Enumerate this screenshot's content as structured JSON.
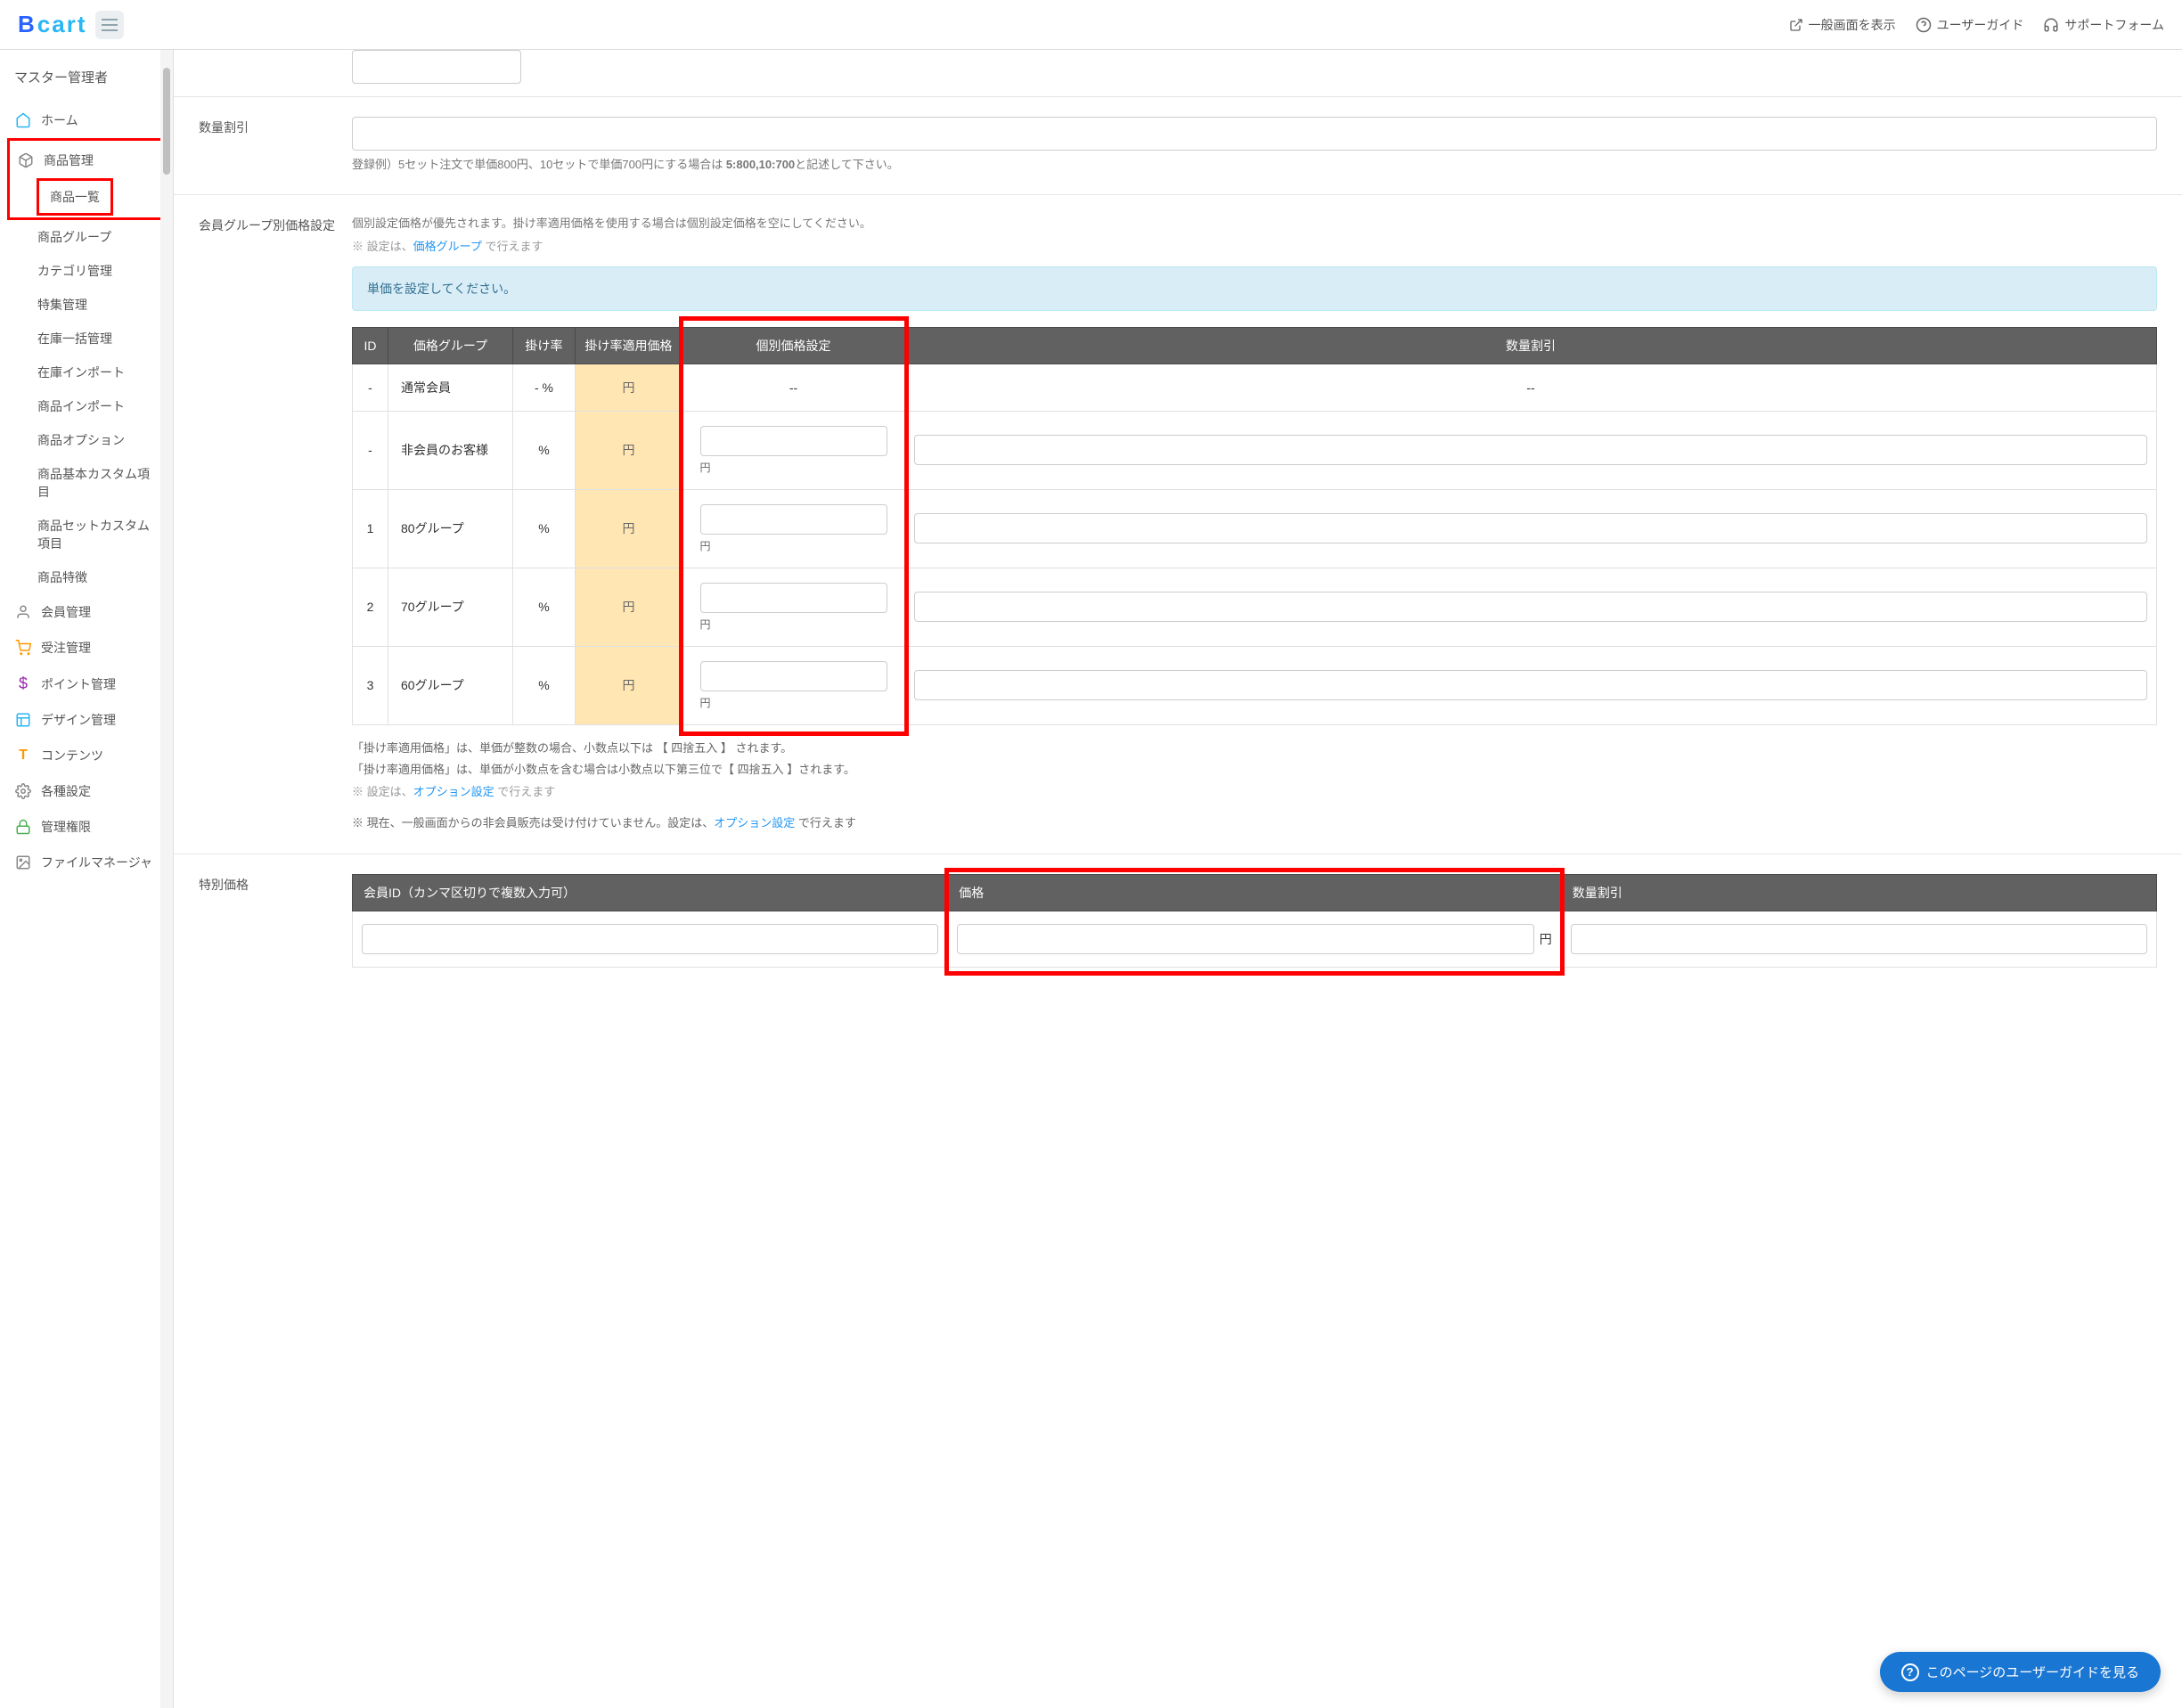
{
  "header": {
    "logo_b": "B",
    "logo_cart": "cart",
    "view_general": "一般画面を表示",
    "user_guide": "ユーザーガイド",
    "support_form": "サポートフォーム"
  },
  "sidebar": {
    "role": "マスター管理者",
    "home": "ホーム",
    "product_mgmt": "商品管理",
    "product_list": "商品一覧",
    "product_group": "商品グループ",
    "category_mgmt": "カテゴリ管理",
    "feature_mgmt": "特集管理",
    "stock_batch": "在庫一括管理",
    "stock_import": "在庫インポート",
    "product_import": "商品インポート",
    "product_option": "商品オプション",
    "product_basic_custom": "商品基本カスタム項目",
    "product_set_custom": "商品セットカスタム項目",
    "product_feature": "商品特徴",
    "member_mgmt": "会員管理",
    "order_mgmt": "受注管理",
    "point_mgmt": "ポイント管理",
    "design_mgmt": "デザイン管理",
    "contents": "コンテンツ",
    "settings": "各種設定",
    "admin_auth": "管理権限",
    "file_manager": "ファイルマネージャ"
  },
  "form": {
    "qty_discount_label": "数量割引",
    "qty_discount_hint_pre": "登録例）5セット注文で単価800円、10セットで単価700円にする場合は ",
    "qty_discount_hint_bold": "5:800,10:700",
    "qty_discount_hint_post": "と記述して下さい。",
    "group_price_label": "会員グループ別価格設定",
    "group_price_hint1": "個別設定価格が優先されます。掛け率適用価格を使用する場合は個別設定価格を空にしてください。",
    "group_price_hint2_pre": "※ 設定は、",
    "group_price_hint2_link": "価格グループ",
    "group_price_hint2_post": " で行えます",
    "banner": "単価を設定してください。",
    "special_price_label": "特別価格",
    "notes_line1": "「掛け率適用価格」は、単価が整数の場合、小数点以下は 【 四捨五入 】 されます。",
    "notes_line2": "「掛け率適用価格」は、単価が小数点を含む場合は小数点以下第三位で【 四捨五入 】されます。",
    "notes_line3_pre": "※ 設定は、",
    "notes_line3_link": "オプション設定",
    "notes_line3_post": " で行えます",
    "notes_line4_pre": "※ 現在、一般画面からの非会員販売は受け付けていません。設定は、",
    "notes_line4_link": "オプション設定",
    "notes_line4_post": " で行えます"
  },
  "price_table": {
    "headers": {
      "id": "ID",
      "group": "価格グループ",
      "rate": "掛け率",
      "apply_price": "掛け率適用価格",
      "indiv_price": "個別価格設定",
      "qty_discount": "数量割引"
    },
    "yen": "円",
    "percent": "%",
    "dash": "-",
    "double_dash": "--",
    "dash_percent": "- %",
    "rows": [
      {
        "id": "-",
        "name": "通常会員",
        "rate": "- %",
        "apply": "円",
        "indiv": "--",
        "qty": "--",
        "editable": false
      },
      {
        "id": "-",
        "name": "非会員のお客様",
        "rate": "%",
        "apply": "円",
        "editable": true
      },
      {
        "id": "1",
        "name": "80グループ",
        "rate": "%",
        "apply": "円",
        "editable": true
      },
      {
        "id": "2",
        "name": "70グループ",
        "rate": "%",
        "apply": "円",
        "editable": true
      },
      {
        "id": "3",
        "name": "60グループ",
        "rate": "%",
        "apply": "円",
        "editable": true
      }
    ]
  },
  "special_table": {
    "headers": {
      "member_id": "会員ID（カンマ区切りで複数入力可）",
      "price": "価格",
      "qty_discount": "数量割引"
    },
    "yen": "円"
  },
  "float_button": "このページのユーザーガイドを見る"
}
